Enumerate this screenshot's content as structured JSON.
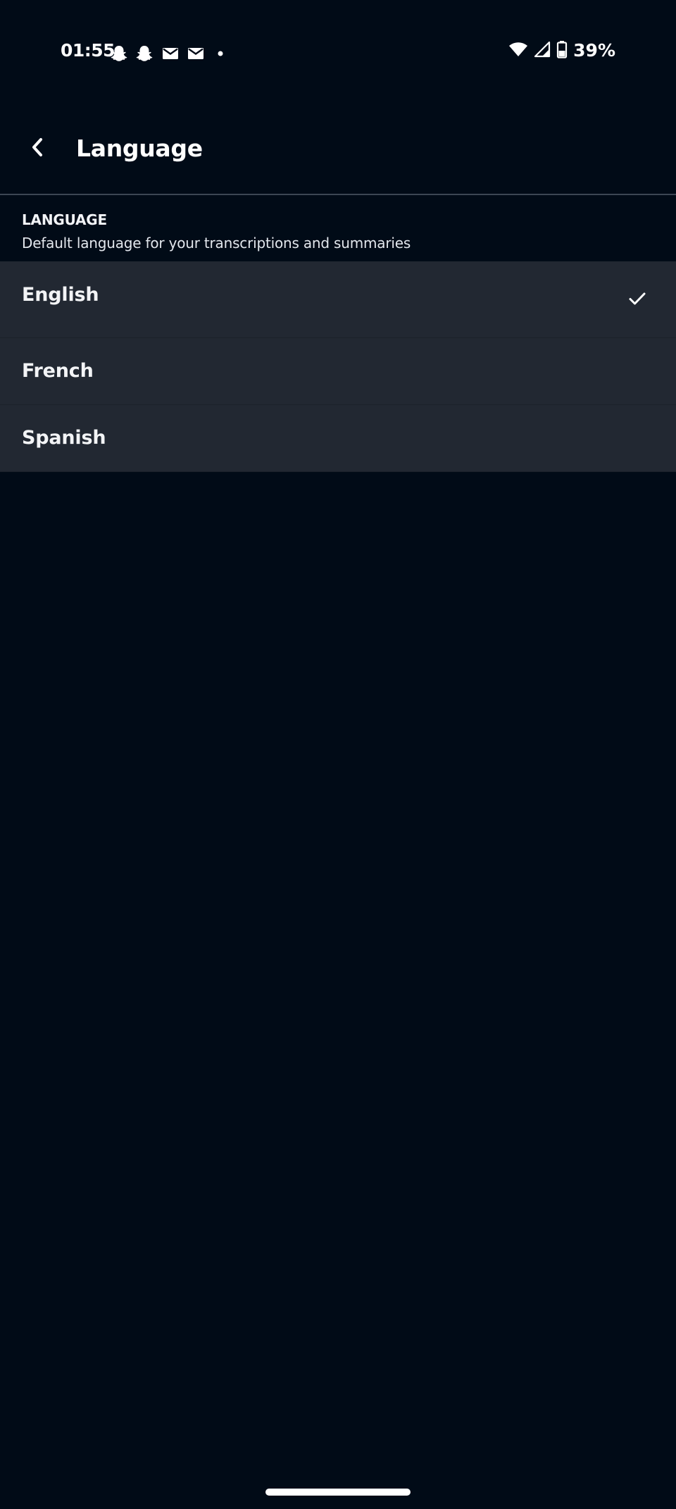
{
  "status_bar": {
    "time": "01:55",
    "notification_icons": [
      "snapchat-icon",
      "snapchat-icon",
      "gmail-icon",
      "gmail-icon",
      "more-notifications-dot-icon"
    ],
    "battery_percent": "39%"
  },
  "header": {
    "title": "Language"
  },
  "section": {
    "title": "LANGUAGE",
    "subtitle": "Default language for your transcriptions and summaries"
  },
  "languages": [
    {
      "label": "English",
      "selected": true
    },
    {
      "label": "French",
      "selected": false
    },
    {
      "label": "Spanish",
      "selected": false
    }
  ],
  "colors": {
    "background": "#010b17",
    "row_background": "#222832",
    "divider": "#3c4653",
    "text": "#ffffff"
  }
}
